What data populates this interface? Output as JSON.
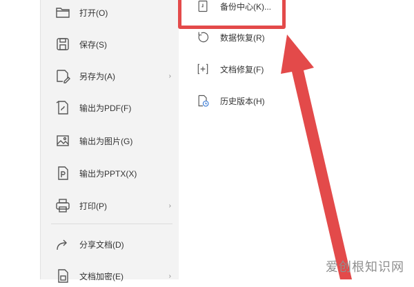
{
  "file_menu": {
    "items": [
      {
        "label": "打开(O)",
        "icon": "folder-open-icon",
        "has_submenu": false
      },
      {
        "label": "保存(S)",
        "icon": "save-icon",
        "has_submenu": false
      },
      {
        "label": "另存为(A)",
        "icon": "save-as-icon",
        "has_submenu": true
      },
      {
        "label": "输出为PDF(F)",
        "icon": "export-pdf-icon",
        "has_submenu": false
      },
      {
        "label": "输出为图片(G)",
        "icon": "export-image-icon",
        "has_submenu": false
      },
      {
        "label": "输出为PPTX(X)",
        "icon": "export-pptx-icon",
        "has_submenu": false
      },
      {
        "label": "打印(P)",
        "icon": "print-icon",
        "has_submenu": true
      },
      {
        "label": "分享文档(D)",
        "icon": "share-icon",
        "has_submenu": false
      },
      {
        "label": "文档加密(E)",
        "icon": "encrypt-icon",
        "has_submenu": true
      }
    ],
    "submenu_arrow": "›"
  },
  "submenu": {
    "items": [
      {
        "label": "备份中心(K)...",
        "icon": "backup-center-icon"
      },
      {
        "label": "数据恢复(R)",
        "icon": "data-recovery-icon"
      },
      {
        "label": "文档修复(F)",
        "icon": "document-repair-icon"
      },
      {
        "label": "历史版本(H)",
        "icon": "history-version-icon"
      }
    ]
  },
  "annotation": {
    "highlight_color": "#e34a4a"
  },
  "watermark": {
    "text": "爱创根知识网"
  }
}
